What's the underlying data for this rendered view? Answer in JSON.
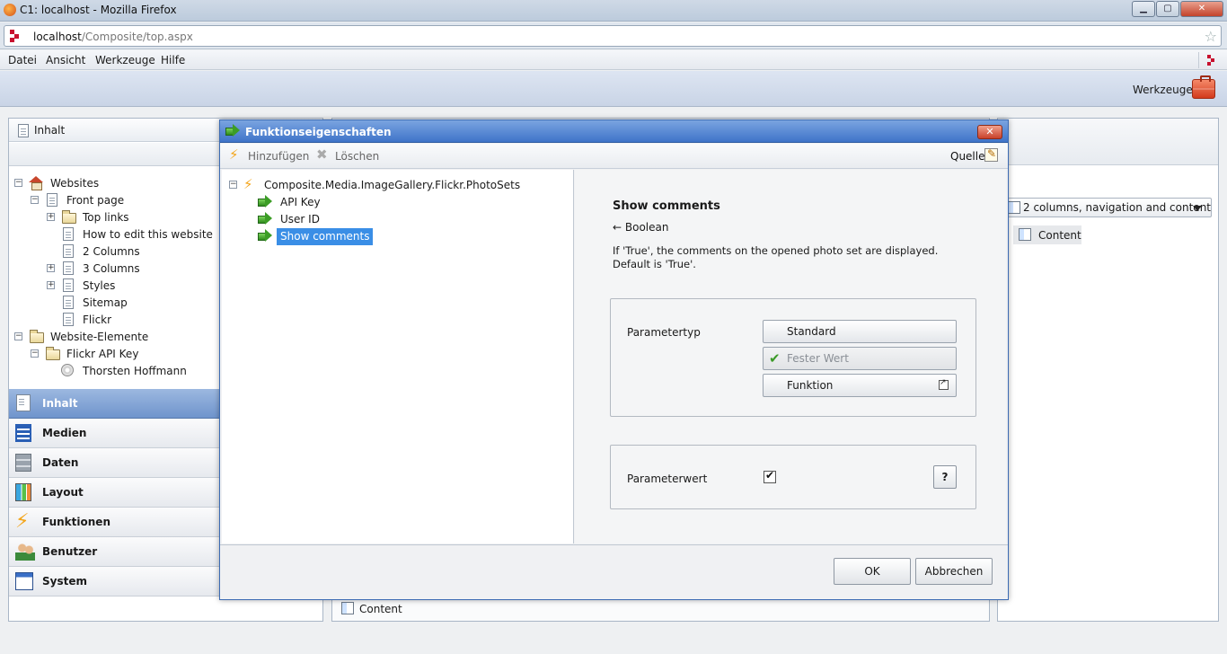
{
  "browser": {
    "window_title": "C1: localhost - Mozilla Firefox",
    "url_host": "localhost",
    "url_path": "/Composite/top.aspx",
    "menu": [
      "Datei",
      "Ansicht",
      "Werkzeuge",
      "Hilfe"
    ]
  },
  "app": {
    "tools_label": "Werkzeuge",
    "left_header": "Inhalt",
    "tree": [
      {
        "label": "Websites",
        "icon": "home-icon",
        "toggle": "−"
      },
      {
        "label": "Front page",
        "icon": "page-icon",
        "toggle": "−"
      },
      {
        "label": "Top links",
        "icon": "folder-icon",
        "toggle": "+"
      },
      {
        "label": "How to edit this website",
        "icon": "page-icon",
        "toggle": ""
      },
      {
        "label": "2 Columns",
        "icon": "page-icon",
        "toggle": ""
      },
      {
        "label": "3 Columns",
        "icon": "page-icon",
        "toggle": "+"
      },
      {
        "label": "Styles",
        "icon": "page-icon",
        "toggle": "+"
      },
      {
        "label": "Sitemap",
        "icon": "page-icon",
        "toggle": ""
      },
      {
        "label": "Flickr",
        "icon": "page-icon",
        "toggle": ""
      },
      {
        "label": "Website-Elemente",
        "icon": "folder-icon",
        "toggle": "−"
      },
      {
        "label": "Flickr API Key",
        "icon": "folder-icon",
        "toggle": "−"
      },
      {
        "label": "Thorsten Hoffmann",
        "icon": "disc-icon",
        "toggle": ""
      }
    ],
    "perspectives": [
      {
        "label": "Inhalt",
        "icon": "content-icon",
        "active": true
      },
      {
        "label": "Medien",
        "icon": "film-icon",
        "active": false
      },
      {
        "label": "Daten",
        "icon": "database-icon",
        "active": false
      },
      {
        "label": "Layout",
        "icon": "layout-icon",
        "active": false
      },
      {
        "label": "Funktionen",
        "icon": "bolt-icon",
        "active": false
      },
      {
        "label": "Benutzer",
        "icon": "users-icon",
        "active": false
      },
      {
        "label": "System",
        "icon": "system-icon",
        "active": false
      }
    ],
    "layout_selector": "2 columns, navigation and content",
    "content_item": "Content",
    "bottom_content": "Content"
  },
  "dialog": {
    "title": "Funktionseigenschaften",
    "add_label": "Hinzufügen",
    "delete_label": "Löschen",
    "source_label": "Quelle",
    "tree": {
      "root": "Composite.Media.ImageGallery.Flickr.PhotoSets",
      "children": [
        "API Key",
        "User ID",
        "Show comments"
      ]
    },
    "detail": {
      "heading": "Show comments",
      "type": "← Boolean",
      "description": "If 'True', the comments on the opened photo set are displayed. Default is 'True'."
    },
    "param_type_label": "Parametertyp",
    "options": [
      "Standard",
      "Fester Wert",
      "Funktion"
    ],
    "selected_option": "Fester Wert",
    "param_value_label": "Parameterwert",
    "param_value_checked": true,
    "help_label": "?",
    "ok_label": "OK",
    "cancel_label": "Abbrechen"
  }
}
